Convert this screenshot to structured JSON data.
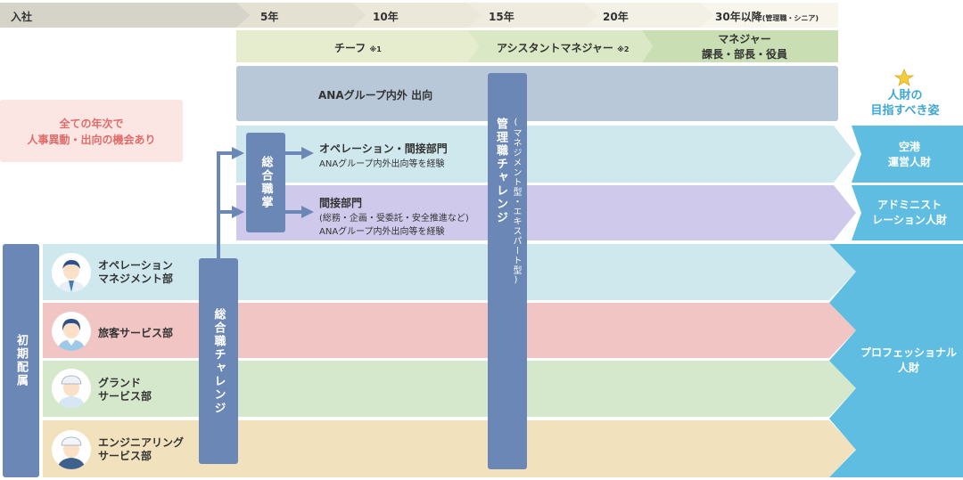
{
  "timeline": {
    "start": "入社",
    "years": [
      "5年",
      "10年",
      "15年",
      "20年"
    ],
    "last": "30年以降",
    "last_note": "(管理職・シニア)"
  },
  "roles": {
    "chief": "チーフ",
    "chief_note": "※1",
    "assistant": "アシスタントマネジャー",
    "assistant_note": "※2",
    "manager_line1": "マネジャー",
    "manager_line2": "課長・部長・役員"
  },
  "ana_group": "ANAグループ内外 出向",
  "all_years": {
    "line1": "全ての年次で",
    "line2": "人事異動・出向の機会あり"
  },
  "general_post": "総合職掌",
  "paths": {
    "operation_title": "オペレーション・間接部門",
    "operation_sub": "ANAグループ内外出向等を経験",
    "indirect_title": "間接部門",
    "indirect_sub1": "(総務・企画・受委託・安全推進など)",
    "indirect_sub2": "ANAグループ内外出向等を経験"
  },
  "management_challenge": {
    "main": "管理職チャレンジ",
    "sub": "(マネジメント型・エキスパート型)"
  },
  "general_challenge": "総合職チャレンジ",
  "initial": "初期配属",
  "departments": [
    {
      "line1": "オペレーション",
      "line2": "マネジメント部"
    },
    {
      "line1": "旅客サービス部",
      "line2": ""
    },
    {
      "line1": "グランド",
      "line2": "サービス部"
    },
    {
      "line1": "エンジニアリング",
      "line2": "サービス部"
    }
  ],
  "goal": {
    "line1": "人財の",
    "line2": "目指すべき姿"
  },
  "outcomes": {
    "airport_line1": "空港",
    "airport_line2": "運営人財",
    "admin_line1": "アドミニスト",
    "admin_line2": "レーション人財",
    "pro_line1": "プロフェッショナル",
    "pro_line2": "人財"
  },
  "colors": {
    "operation_band": "#cfe8ee",
    "indirect_band": "#cfc9ec",
    "ana_band": "#b9c8d9",
    "pink_band": "#f0c5c3",
    "green_band": "#d6e8cc",
    "yellow_band": "#f1e2bd",
    "bar_blue": "#6a87b5",
    "outcome_blue": "#5ebde0"
  }
}
